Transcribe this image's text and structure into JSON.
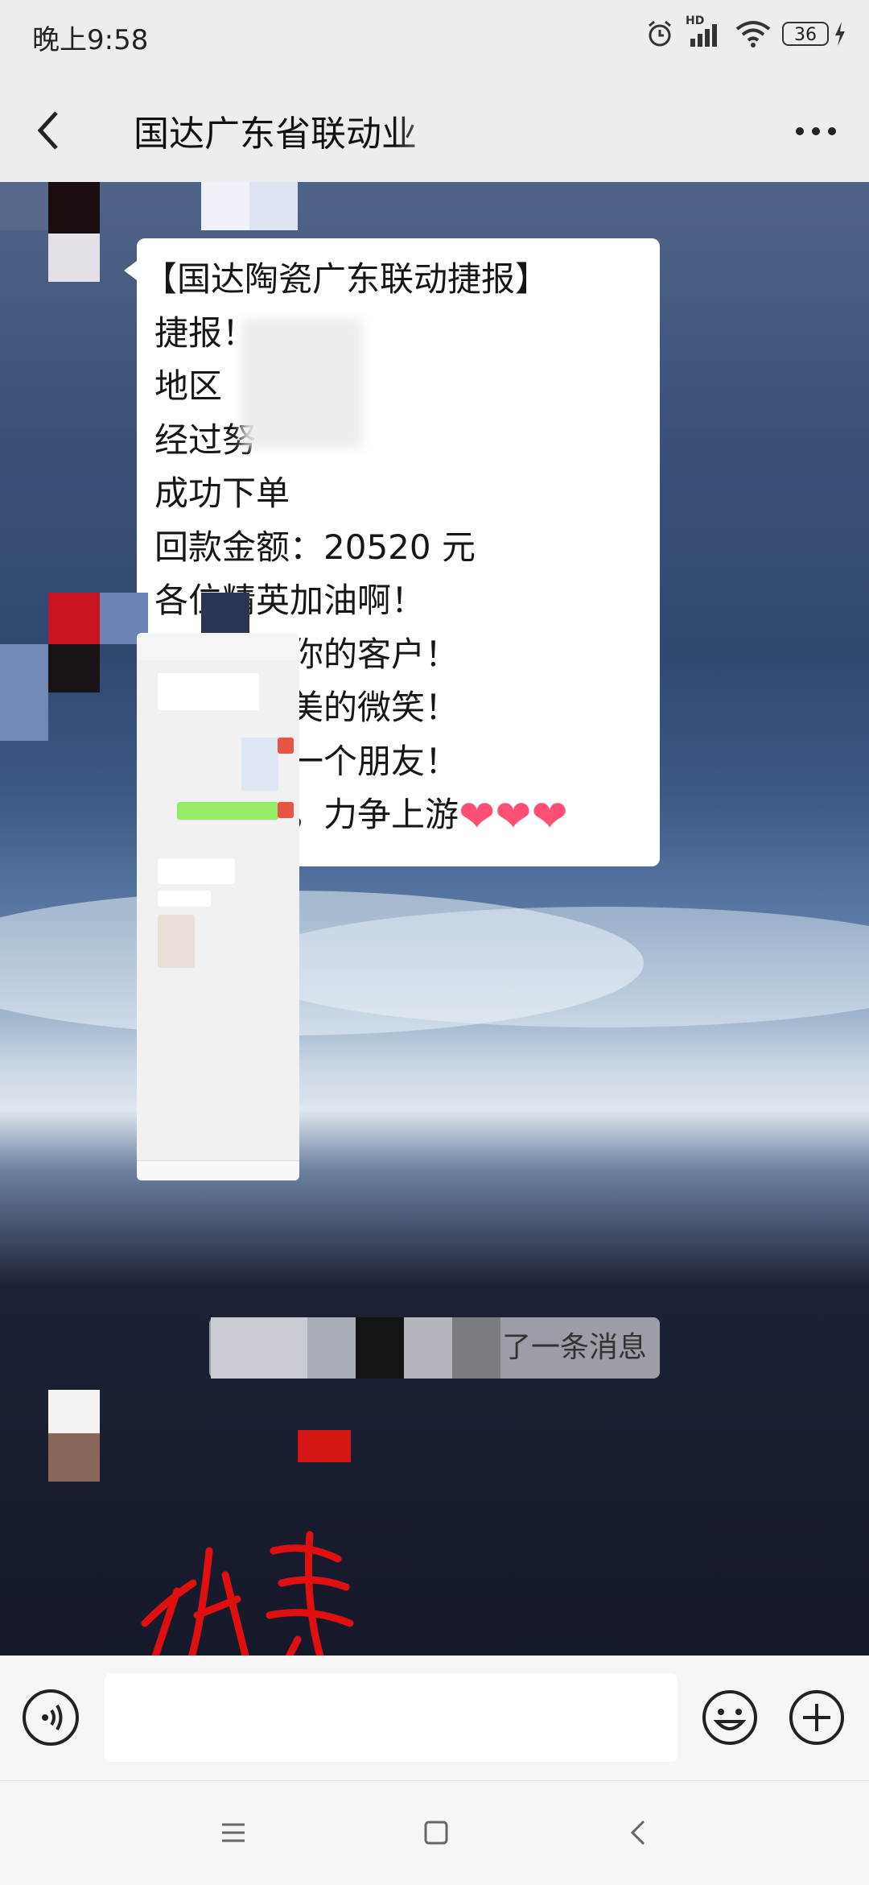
{
  "status_bar": {
    "time": "晚上9:58",
    "network_label": "HD",
    "battery": "36"
  },
  "header": {
    "title": "国达广东省联动业"
  },
  "messages": {
    "announcement_lines": [
      "【国达陶瓷广东联动捷报】",
      "捷报！",
      "地区",
      "经过努",
      "成功下单",
      "回款金额：20520 元",
      "各位精英加油啊！",
      "用真心爱你的客户！",
      "保持你最美的微笑！",
      "做一单交一个朋友！",
      "继续努力，力争上游"
    ],
    "hearts": "❤❤❤",
    "system_notice": "了一条消息"
  },
  "input": {
    "placeholder": ""
  },
  "icons": {
    "back": "back-arrow-icon",
    "more": "more-dots-icon",
    "voice": "voice-icon",
    "emoji": "emoji-icon",
    "plus": "plus-icon",
    "nav_menu": "menu-icon",
    "nav_home": "home-square-icon",
    "nav_back": "back-chevron-icon"
  },
  "colors": {
    "bubble": "#ffffff",
    "heart": "#ff4f74",
    "bar": "#ededed"
  }
}
